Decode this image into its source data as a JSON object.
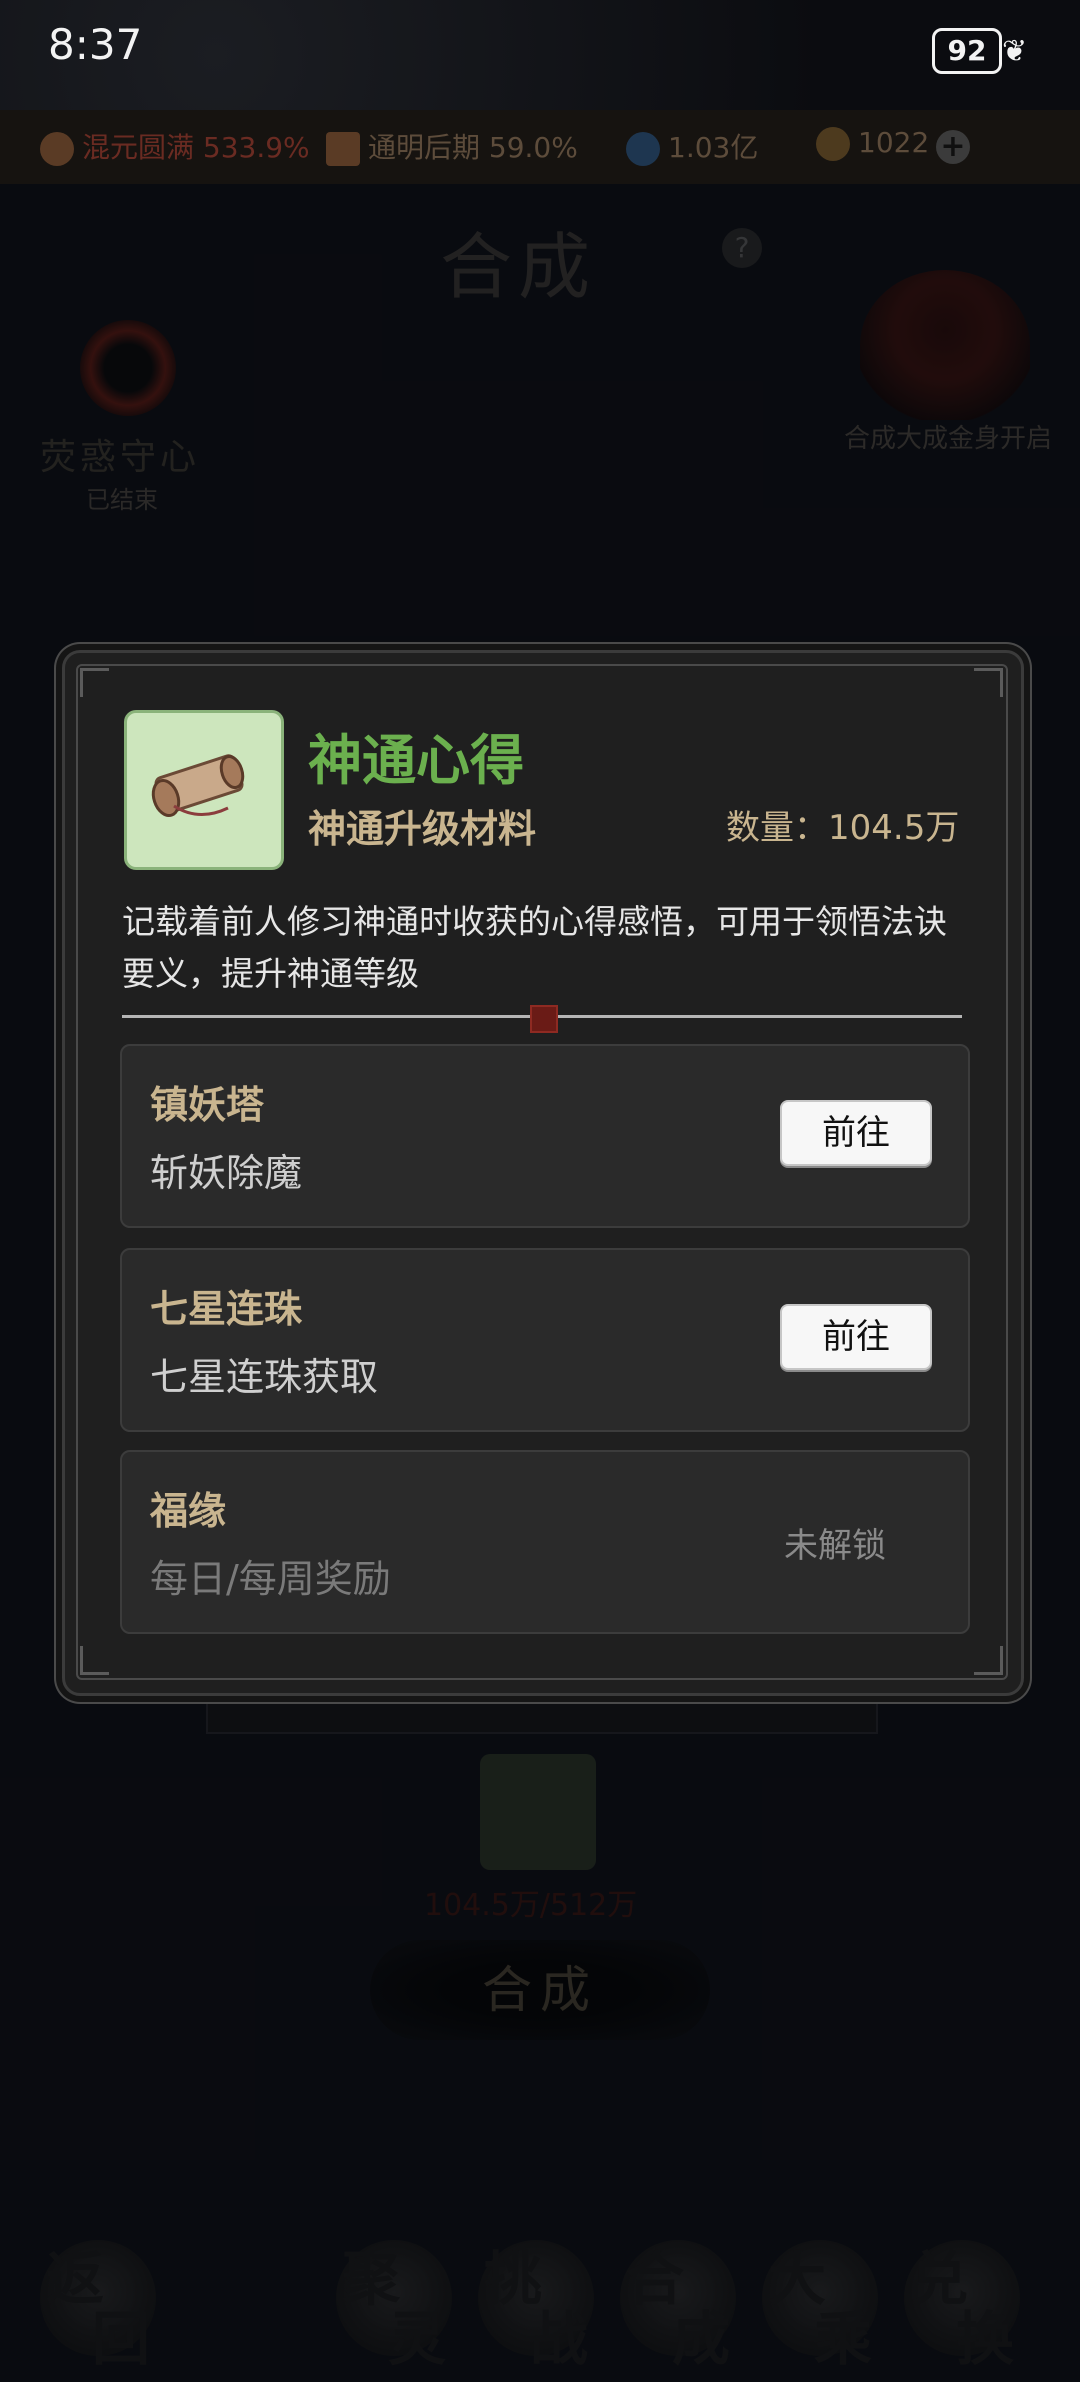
{
  "status_bar": {
    "time": "8:37",
    "battery": "92"
  },
  "resources": [
    {
      "icon": "realm-icon",
      "text": "混元圆满 533.9%"
    },
    {
      "icon": "brush-icon",
      "text": "通明后期 59.0%"
    },
    {
      "icon": "spirit-drop-icon",
      "text": "1.03亿"
    },
    {
      "icon": "coin-icon",
      "text": "1022"
    }
  ],
  "page": {
    "title": "合成",
    "left_event": {
      "name": "荧惑守心",
      "status": "已结束"
    },
    "right_event": {
      "label": "合成大成金身开启"
    },
    "progress": "104.5万/512万",
    "merge_button": "合成"
  },
  "dialog": {
    "item_name": "神通心得",
    "item_type": "神通升级材料",
    "quantity": "数量：104.5万",
    "description": "记载着前人修习神通时收获的心得感悟，可用于领悟法诀要义，提升神通等级",
    "sources": [
      {
        "title": "镇妖塔",
        "subtitle": "斩妖除魔",
        "action": "前往"
      },
      {
        "title": "七星连珠",
        "subtitle": "七星连珠获取",
        "action": "前往"
      },
      {
        "title": "福缘",
        "subtitle": "每日/每周奖励",
        "status": "未解锁"
      }
    ]
  },
  "bottom_nav": [
    {
      "label": "返回",
      "c1": "返",
      "c2": "回"
    },
    {
      "label": "聚灵",
      "c1": "聚",
      "c2": "灵"
    },
    {
      "label": "挑战",
      "c1": "挑",
      "c2": "战"
    },
    {
      "label": "合成",
      "c1": "合",
      "c2": "成"
    },
    {
      "label": "大乘",
      "c1": "大",
      "c2": "乘"
    },
    {
      "label": "兑换",
      "c1": "兑",
      "c2": "换"
    }
  ],
  "colors": {
    "item_name": "#6bb04e",
    "gold_text": "#c9b58f",
    "item_bg": "#cde6bd"
  }
}
